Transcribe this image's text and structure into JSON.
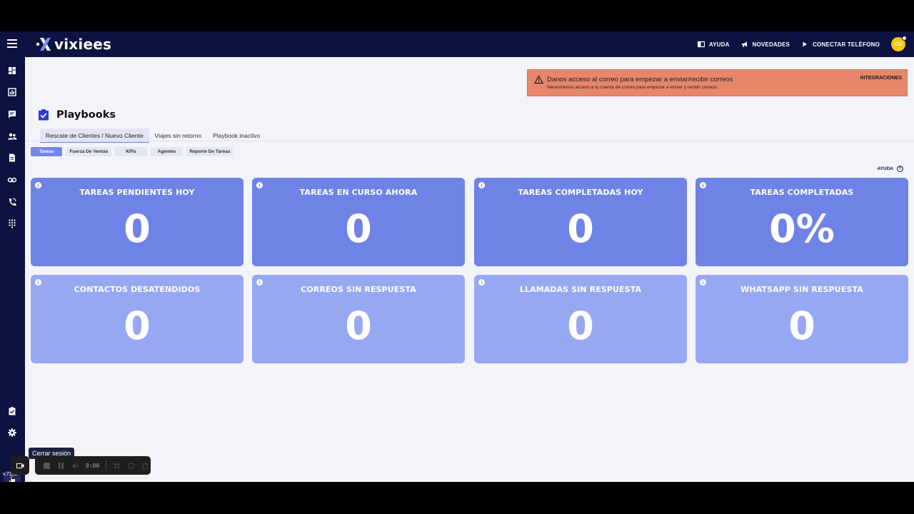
{
  "brand": {
    "name": "vixiees"
  },
  "header": {
    "actions": [
      {
        "label": "AYUDA",
        "icon": "book-icon"
      },
      {
        "label": "NOVEDADES",
        "icon": "megaphone-icon"
      },
      {
        "label": "CONECTAR TELÉFONO",
        "icon": "play-icon"
      }
    ],
    "avatar_initials": "CU"
  },
  "sidebar": {
    "items": [
      {
        "icon": "dashboard-icon"
      },
      {
        "icon": "analytics-icon"
      },
      {
        "icon": "chat-icon"
      },
      {
        "icon": "contacts-icon"
      },
      {
        "icon": "document-icon"
      },
      {
        "icon": "voicemail-icon"
      },
      {
        "icon": "phone-call-icon"
      },
      {
        "icon": "dialpad-icon"
      }
    ],
    "bottom_items": [
      {
        "icon": "playbook-check-icon"
      },
      {
        "icon": "settings-gear-icon"
      }
    ],
    "version": "v.7222"
  },
  "alert": {
    "title": "Danos acceso al correo para empezar a enviar/recibir correos",
    "subtitle": "Necesitamos acceso a tu cuenta de correo para empezar a enviar y recibir correos.",
    "link": "INTEGRACIONES",
    "color": "#e7866a"
  },
  "page": {
    "title": "Playbooks",
    "tabs": [
      "Rescate de Clientes / Nuevo Cliente",
      "Viajes sin retorno",
      "Playbook inactivo"
    ],
    "subtabs": [
      "Tareas",
      "Fuerza De Ventas",
      "KPIs",
      "Agentes",
      "Reporte De Tareas"
    ],
    "help_label": "AYUDA"
  },
  "cards": [
    {
      "title": "TAREAS PENDIENTES HOY",
      "value": "0"
    },
    {
      "title": "TAREAS EN CURSO AHORA",
      "value": "0"
    },
    {
      "title": "TAREAS COMPLETADAS HOY",
      "value": "0"
    },
    {
      "title": "TAREAS COMPLETADAS",
      "value": "0%"
    },
    {
      "title": "CONTACTOS DESATENDIDOS",
      "value": "0"
    },
    {
      "title": "CORREOS SIN RESPUESTA",
      "value": "0"
    },
    {
      "title": "LLAMADAS SIN RESPUESTA",
      "value": "0"
    },
    {
      "title": "WHATSAPP SIN RESPUESTA",
      "value": "0"
    }
  ],
  "colors": {
    "header": "#0d1240",
    "card_primary": "#6f83e6",
    "card_secondary": "#97a8f3",
    "accent": "#7387e7"
  },
  "tooltip": {
    "text": "Cerrar sesión"
  },
  "recorder": {
    "time": "0:00"
  }
}
